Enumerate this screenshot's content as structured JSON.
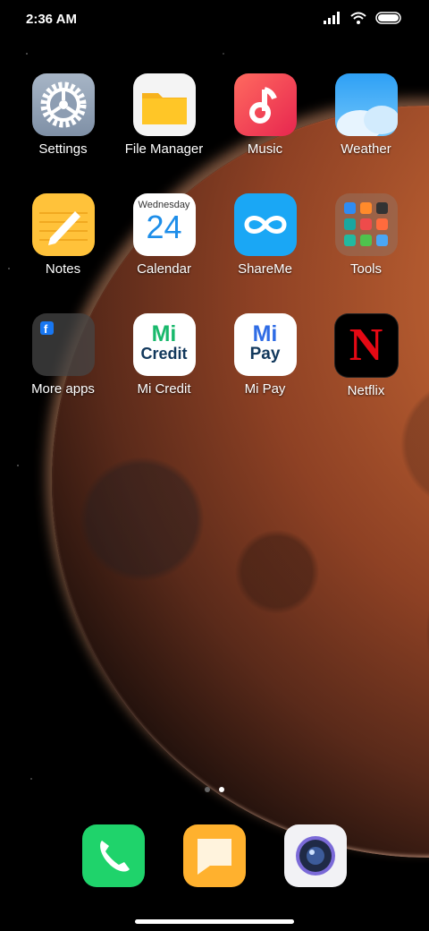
{
  "status_bar": {
    "time": "2:36 AM",
    "icons": [
      "signal-icon",
      "wifi-icon",
      "battery-icon"
    ]
  },
  "apps": [
    {
      "name": "settings",
      "label": "Settings"
    },
    {
      "name": "file-manager",
      "label": "File Manager"
    },
    {
      "name": "music",
      "label": "Music"
    },
    {
      "name": "weather",
      "label": "Weather"
    },
    {
      "name": "notes",
      "label": "Notes"
    },
    {
      "name": "calendar",
      "label": "Calendar",
      "weekday": "Wednesday",
      "day": "24"
    },
    {
      "name": "shareme",
      "label": "ShareMe"
    },
    {
      "name": "tools",
      "label": "Tools"
    },
    {
      "name": "more-apps",
      "label": "More apps"
    },
    {
      "name": "mi-credit",
      "label": "Mi Credit",
      "logo_top": "Mi",
      "logo_bottom": "Credit"
    },
    {
      "name": "mi-pay",
      "label": "Mi Pay",
      "logo_top": "Mi",
      "logo_bottom": "Pay"
    },
    {
      "name": "netflix",
      "label": "Netflix",
      "logo": "N"
    }
  ],
  "page_indicator": {
    "pages": 2,
    "current": 2
  },
  "dock": [
    {
      "name": "phone"
    },
    {
      "name": "messages"
    },
    {
      "name": "camera"
    }
  ],
  "colors": {
    "shareme": "#1aa7f5",
    "phone": "#1fd36b",
    "messages": "#ffb12e",
    "netflix_red": "#e50914",
    "mi_credit_green": "#19b96c",
    "mi_pay_blue": "#2f6ce5"
  }
}
